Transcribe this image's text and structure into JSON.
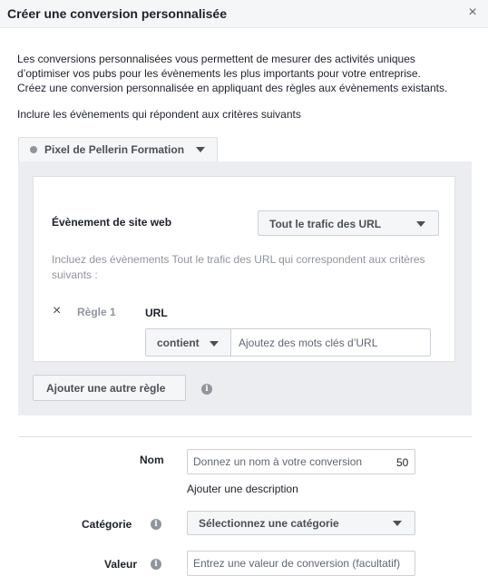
{
  "dialog": {
    "title": "Créer une conversion personnalisée",
    "close_icon": "×"
  },
  "intro": {
    "line1": "Les conversions personnalisées vous permettent de mesurer des activités uniques",
    "line2": "d’optimiser vos pubs pour les évènements les plus importants pour votre entreprise.",
    "line3": "Créez une conversion personnalisée en appliquant des règles aux évènements existants."
  },
  "include_label": "Inclure les évènements qui répondent aux critères suivants",
  "pixel": {
    "label": "Pixel de Pellerin Formation",
    "status_color": "#90949c"
  },
  "rules": {
    "event_label": "Évènement de site web",
    "event_select": "Tout le trafic des URL",
    "helper": "Incluez des évènements Tout le trafic des URL qui correspondent aux critères suivants :",
    "rule1": {
      "label": "Règle 1",
      "remove_icon": "×",
      "field": "URL",
      "operator": "contient",
      "placeholder": "Ajoutez des mots clés d’URL"
    },
    "add_rule": "Ajouter une autre règle"
  },
  "form": {
    "name_label": "Nom",
    "name_placeholder": "Donnez un nom à votre conversion",
    "name_remaining": "50",
    "add_description": "Ajouter une description",
    "category_label": "Catégorie",
    "category_select": "Sélectionnez une catégorie",
    "value_label": "Valeur",
    "value_placeholder": "Entrez une valeur de conversion (facultatif)"
  },
  "icons": {
    "info": "i"
  },
  "colors": {
    "header_bg": "#f5f6f7",
    "panel_bg": "#ebedf0",
    "text": "#1d2129",
    "muted": "#90949c",
    "border": "#ccd0d5"
  }
}
